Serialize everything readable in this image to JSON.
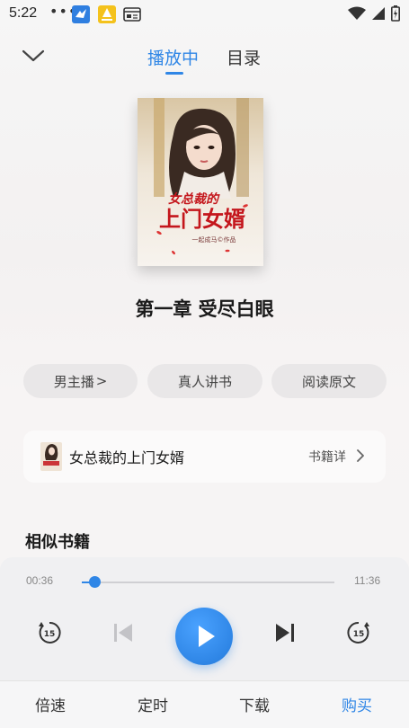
{
  "status_bar": {
    "time": "5:22",
    "dots": "•••",
    "app3_label": "清理加速"
  },
  "header": {
    "tab_playing": "播放中",
    "tab_catalog": "目录"
  },
  "cover": {
    "title_line1": "女总裁的",
    "title_line2": "上门女婿",
    "author_line": "一起成马©作品"
  },
  "chapter_title": "第一章 受尽白眼",
  "pills": {
    "narrator": "男主播",
    "narrator_arrow": ">",
    "real_person": "真人讲书",
    "read_original": "阅读原文"
  },
  "book": {
    "name": "女总裁的上门女婿",
    "detail": "书籍详"
  },
  "similar_title": "相似书籍",
  "player": {
    "current_time": "00:36",
    "total_time": "11:36",
    "progress": 0.052,
    "rewind_seconds": "15",
    "forward_seconds": "15"
  },
  "bottom_bar": {
    "speed": "倍速",
    "timer": "定时",
    "download": "下载",
    "buy": "购买"
  },
  "colors": {
    "accent": "#2f86e6",
    "text": "#1a1a1a",
    "pill_bg": "#e9e7e8"
  }
}
